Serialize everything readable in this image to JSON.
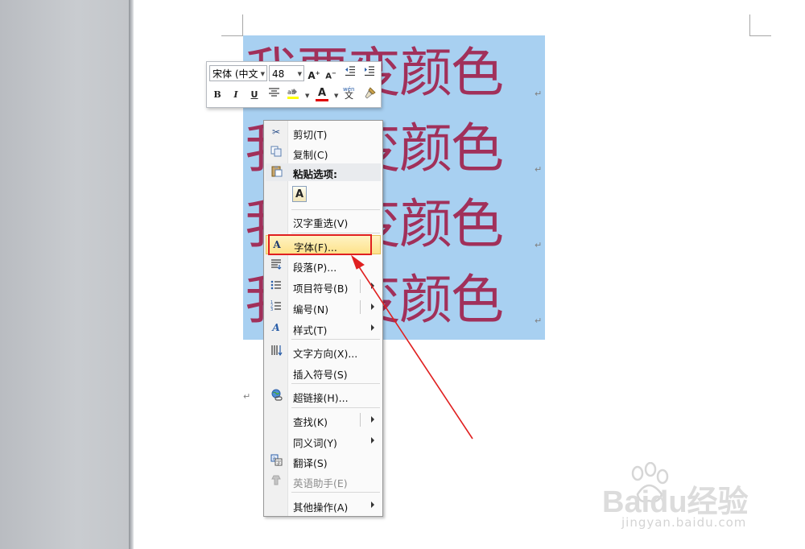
{
  "document": {
    "lines": [
      "我要变颜色",
      "我要变颜色",
      "我要变颜色",
      "我要变颜色"
    ],
    "paragraph_mark": "↵",
    "text_color": "#a1305a",
    "selection_color": "#a8d0f1"
  },
  "mini_toolbar": {
    "font_name": "宋体 (中文",
    "font_size": "48",
    "grow_font": "A",
    "shrink_font": "A",
    "bold": "B",
    "italic": "I",
    "underline": "U",
    "font_color": "A",
    "phonetic": "wén"
  },
  "context_menu": {
    "items": {
      "cut": "剪切(T)",
      "copy": "复制(C)",
      "paste_options": "粘贴选项:",
      "paste_keep_text": "A",
      "hanzi_reconvert": "汉字重选(V)",
      "font": "字体(F)...",
      "paragraph": "段落(P)...",
      "bullets": "项目符号(B)",
      "numbering": "编号(N)",
      "styles": "样式(T)",
      "text_direction": "文字方向(X)...",
      "insert_symbol": "插入符号(S)",
      "hyperlink": "超链接(H)...",
      "find": "查找(K)",
      "synonyms": "同义词(Y)",
      "translate": "翻译(S)",
      "english_assistant": "英语助手(E)",
      "other_actions": "其他操作(A)"
    },
    "highlight_color": "#fde28a",
    "annotation_box_color": "#e02020"
  },
  "watermark": {
    "brand": "Baidu经验",
    "url": "jingyan.baidu.com"
  }
}
